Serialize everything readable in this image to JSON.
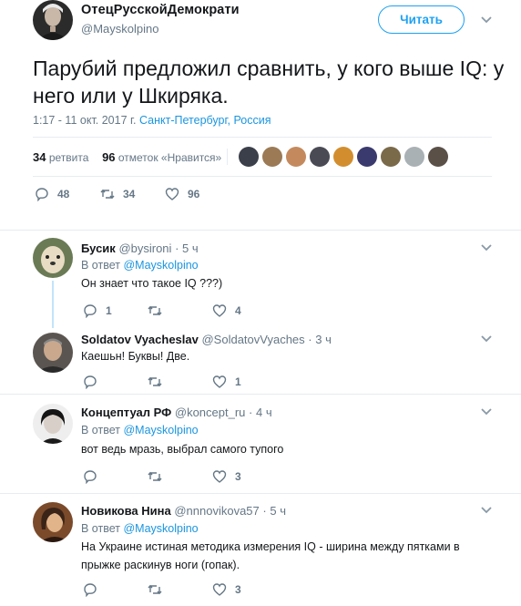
{
  "tweet": {
    "author_name": "ОтецРусскойДемократи",
    "author_handle": "@Mayskolpino",
    "follow_label": "Читать",
    "text": "Парубий предложил сравнить, у кого выше IQ: у него или у Шкиряка.",
    "timestamp": "1:17 - 11 окт. 2017 г.",
    "location": "Санкт-Петербург, Россия",
    "retweets_count": "34",
    "retweets_label": "ретвита",
    "likes_count": "96",
    "likes_label": "отметок «Нравится»",
    "likers": [
      "liker-1",
      "liker-2",
      "liker-3",
      "liker-4",
      "liker-5",
      "liker-6",
      "liker-7",
      "liker-8",
      "liker-9"
    ],
    "actions": {
      "reply_count": "48",
      "retweet_count": "34",
      "like_count": "96"
    }
  },
  "replies": [
    {
      "name": "Бусик",
      "handle": "@bysironi",
      "time": "· 5 ч",
      "in_reply_prefix": "В ответ",
      "in_reply_mention": "@Mayskolpino",
      "text": "Он знает что такое IQ ???)",
      "reply_count": "1",
      "retweet_count": "",
      "like_count": "4"
    },
    {
      "name": "Soldatov Vyacheslav",
      "handle": "@SoldatovVyaches",
      "time": "· 3 ч",
      "text": "Каешьн! Буквы! Две.",
      "reply_count": "",
      "retweet_count": "",
      "like_count": "1"
    },
    {
      "name": "Концептуал РФ",
      "handle": "@koncept_ru",
      "time": "· 4 ч",
      "in_reply_prefix": "В ответ",
      "in_reply_mention": "@Mayskolpino",
      "text": "вот ведь мразь, выбрал самого тупого",
      "reply_count": "",
      "retweet_count": "",
      "like_count": "3"
    },
    {
      "name": "Новикова Нина",
      "handle": "@nnnovikova57",
      "time": "· 5 ч",
      "in_reply_prefix": "В ответ",
      "in_reply_mention": "@Mayskolpino",
      "text_line1": "На Украине истиная методика измерения IQ - ширина между пятками в",
      "text_line2": "прыжке раскинув ноги (гопак).",
      "reply_count": "",
      "retweet_count": "",
      "like_count": "3"
    }
  ],
  "icons": {
    "reply": "reply-icon",
    "retweet": "retweet-icon",
    "like": "heart-icon",
    "more": "chevron-down-icon"
  },
  "colors": {
    "accent": "#1da1f2",
    "link": "#1b95e0",
    "muted": "#657786",
    "text": "#14171a",
    "divider": "#e6ecf0",
    "thread": "#c4e3fb"
  }
}
